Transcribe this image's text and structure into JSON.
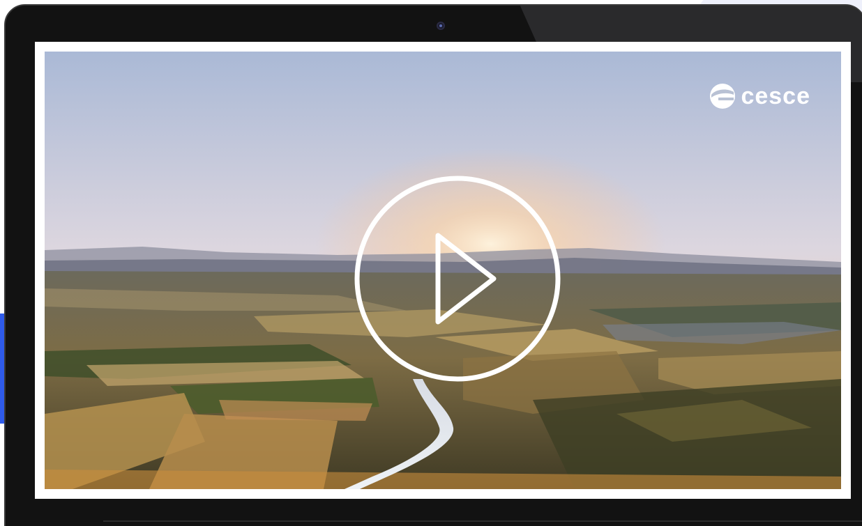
{
  "video": {
    "brand": {
      "name": "cesce",
      "icon": "cesce-logo-icon"
    },
    "play_icon": "play-icon"
  },
  "colors": {
    "accent_bar": "#2f5bea",
    "device_frame": "#121212",
    "screen_border": "#ffffff"
  }
}
